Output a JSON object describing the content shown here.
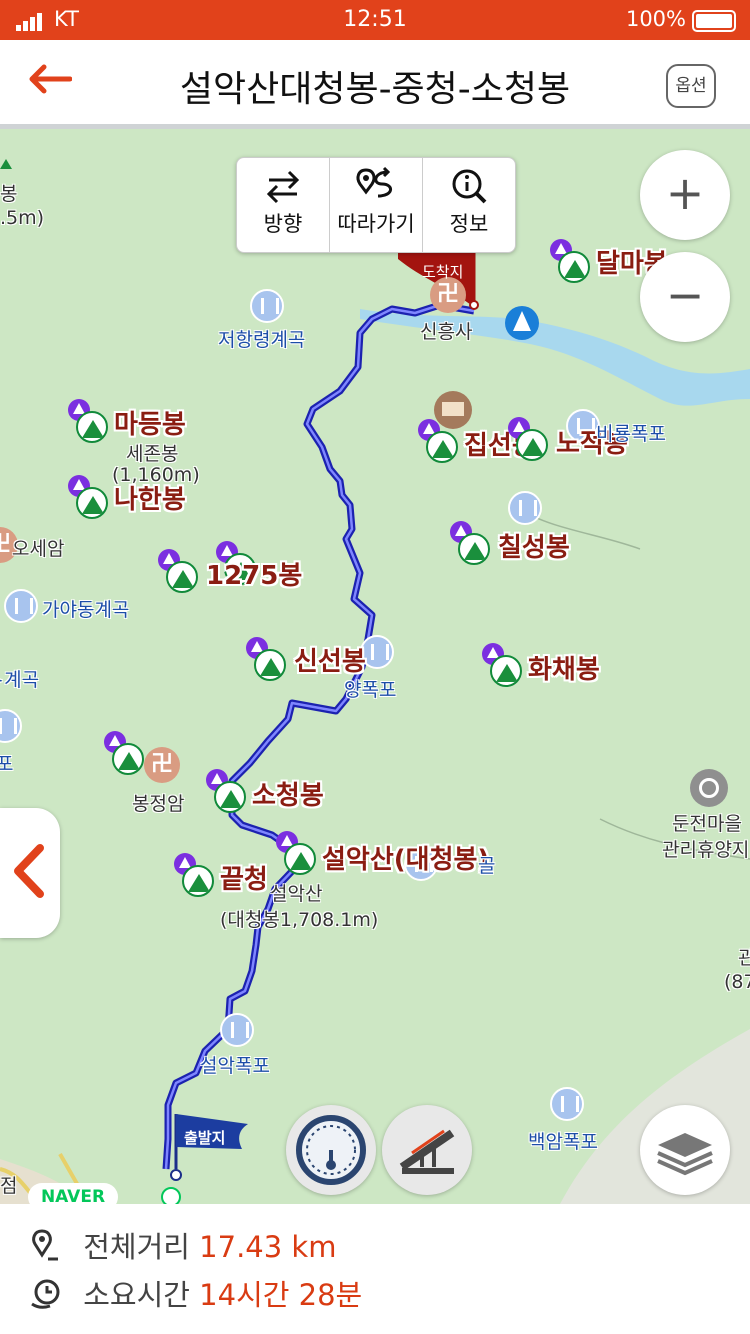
{
  "status_bar": {
    "carrier": "KT",
    "time": "12:51",
    "battery": "100%"
  },
  "header": {
    "back_icon": "arrow-left-icon",
    "title": "설악산대청봉-중청-소청봉",
    "option_label": "옵션"
  },
  "toolbar": [
    {
      "icon": "swap-arrows-icon",
      "label": "방향"
    },
    {
      "icon": "follow-route-icon",
      "label": "따라가기"
    },
    {
      "icon": "info-search-icon",
      "label": "정보"
    }
  ],
  "zoom": {
    "in": "+",
    "out": "−"
  },
  "markers": {
    "start": "출발지",
    "end": "도착지"
  },
  "peaks": [
    {
      "label": "달마봉"
    },
    {
      "label": "마등봉"
    },
    {
      "label": "나한봉"
    },
    {
      "label": "1275봉"
    },
    {
      "label": "집선봉"
    },
    {
      "label": "노적봉"
    },
    {
      "label": "칠성봉"
    },
    {
      "label": "신선봉"
    },
    {
      "label": "화채봉"
    },
    {
      "label": "소청봉"
    },
    {
      "label": "설악산(대청봉)"
    },
    {
      "label": "끝청"
    }
  ],
  "places": {
    "peak_partial": "봉",
    "elev_partial": ".5m)",
    "jeohang": "저항령계곡",
    "sinheungsa": "신흥사",
    "sejonbong": "세존봉",
    "sejonbong_elev": "(1,160m)",
    "oseam": "오세암",
    "gayadong": "가야동계곡",
    "valley_partial": "}계곡",
    "falls_partial": "포",
    "bongjeongam": "봉정암",
    "daecheong_name": "설악산",
    "daecheong_elev": "(대청봉1,708.1m)",
    "fall_near_sinseon": "양폭포",
    "fall_biryong": "비룡폭포",
    "seorak_fall": "설악폭포",
    "baekam": "백암폭포",
    "dunjeon1": "둔전마을",
    "dunjeon2": "관리휴양지",
    "gwan_partial": "관",
    "gwan_elev_partial": "(87",
    "jeobgol_partial": "골",
    "left_partial": "점"
  },
  "naver_logo": "NAVER",
  "summary": {
    "distance_label": "전체거리",
    "distance_value": "17.43 km",
    "time_label": "소요시간",
    "time_value": "14시간 28분"
  },
  "colors": {
    "accent": "#e1421b",
    "route": "#2f34c8",
    "map_bg": "#cde7c4",
    "peak_label": "#8a1d12",
    "water": "#a8d8ee"
  }
}
